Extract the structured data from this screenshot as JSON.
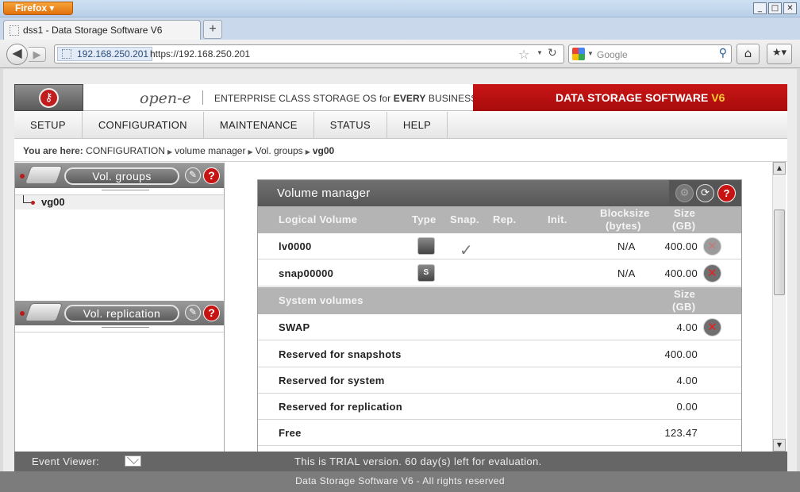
{
  "browser": {
    "app_button": "Firefox",
    "window_controls": [
      "_",
      "□",
      "✕"
    ],
    "tab_title": "dss1 - Data Storage Software V6",
    "new_tab": "+",
    "url_site": "192.168.250.201",
    "url": "https://192.168.250.201",
    "search_placeholder": "Google"
  },
  "header": {
    "logo": "open-e",
    "tagline_pre": "ENTERPRISE CLASS STORAGE OS for ",
    "tagline_bold": "EVERY",
    "tagline_post": " BUSINESS",
    "product": "DATA STORAGE SOFTWARE ",
    "product_version": "V6"
  },
  "menu": [
    "SETUP",
    "CONFIGURATION",
    "MAINTENANCE",
    "STATUS",
    "HELP"
  ],
  "breadcrumb": {
    "label": "You are here:",
    "items": [
      "CONFIGURATION",
      "volume manager",
      "Vol. groups"
    ],
    "current": "vg00"
  },
  "left_panel": {
    "vol_groups_title": "Vol. groups",
    "tree_item": "vg00",
    "vol_replication_title": "Vol. replication"
  },
  "volume_manager": {
    "title": "Volume manager",
    "columns": {
      "name": "Logical Volume",
      "type": "Type",
      "snap": "Snap.",
      "rep": "Rep.",
      "init": "Init.",
      "blocksize": "Blocksize",
      "blocksize_unit": "(bytes)",
      "size": "Size",
      "size_unit": "(GB)"
    },
    "logical_volumes": [
      {
        "name": "lv0000",
        "blocksize": "N/A",
        "size": "400.00"
      },
      {
        "name": "snap00000",
        "blocksize": "N/A",
        "size": "400.00"
      }
    ],
    "system_header": "System volumes",
    "system_size_label": "Size",
    "system_size_unit": "(GB)",
    "system_volumes": [
      {
        "name": "SWAP",
        "size": "4.00"
      },
      {
        "name": "Reserved for snapshots",
        "size": "400.00"
      },
      {
        "name": "Reserved for system",
        "size": "4.00"
      },
      {
        "name": "Reserved for replication",
        "size": "0.00"
      },
      {
        "name": "Free",
        "size": "123.47"
      }
    ]
  },
  "status_bar": {
    "event_viewer": "Event Viewer:",
    "trial": "This is TRIAL version. 60 day(s) left for evaluation."
  },
  "footer": "Data Storage Software V6 - All rights reserved"
}
